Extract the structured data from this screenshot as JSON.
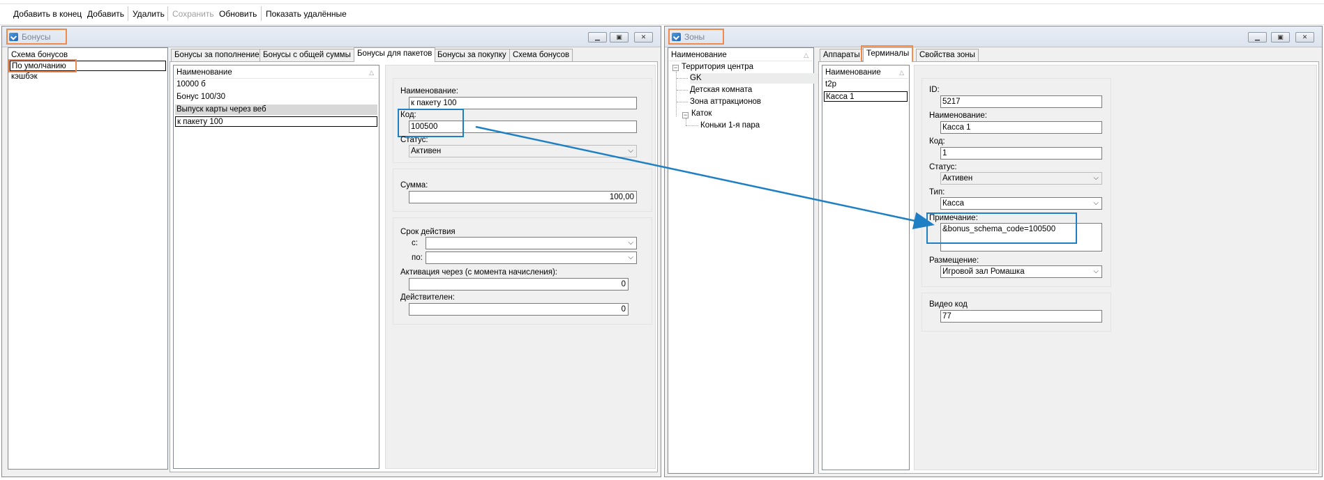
{
  "toolbar": {
    "add_end": "Добавить в конец",
    "add": "Добавить",
    "delete": "Удалить",
    "save": "Сохранить",
    "refresh": "Обновить",
    "show_deleted": "Показать удалённые"
  },
  "bonuses_window": {
    "title": "Бонусы",
    "schemes": [
      "Схема бонусов",
      "По умолчанию",
      "кэшбэк"
    ],
    "tabs": [
      "Бонусы за пополнение",
      "Бонусы с общей суммы",
      "Бонусы для пакетов",
      "Бонусы за покупку",
      "Схема бонусов"
    ],
    "list_header": "Наименование",
    "packages": [
      "10000 б",
      "Бонус 100/30",
      "Выпуск карты через веб",
      "к пакету 100"
    ],
    "form": {
      "name_label": "Наименование:",
      "name_value": "к пакету 100",
      "code_label": "Код:",
      "code_value": "100500",
      "status_label": "Статус:",
      "status_value": "Активен",
      "sum_label": "Сумма:",
      "sum_value": "100,00",
      "validity_label": "Срок действия",
      "from_label": "с:",
      "to_label": "по:",
      "activation_label": "Активация через (с момента начисления):",
      "activation_value": "0",
      "valid_label": "Действителен:",
      "valid_value": "0"
    }
  },
  "zones_window": {
    "title": "Зоны",
    "tree_header": "Наименование",
    "tree": {
      "root": "Территория центра",
      "children": [
        "GK",
        "Детская комната",
        "Зона аттракционов"
      ],
      "rink": "Каток",
      "rink_children": [
        "Коньки 1-я пара"
      ]
    },
    "tabs": [
      "Аппараты",
      "Терминалы",
      "Свойства зоны"
    ],
    "list_header": "Наименование",
    "terminals": [
      "t2p",
      "Касса 1"
    ],
    "form": {
      "id_label": "ID:",
      "id_value": "5217",
      "name_label": "Наименование:",
      "name_value": "Касса 1",
      "code_label": "Код:",
      "code_value": "1",
      "status_label": "Статус:",
      "status_value": "Активен",
      "type_label": "Тип:",
      "type_value": "Касса",
      "note_label": "Примечание:",
      "note_value": "&bonus_schema_code=100500",
      "placement_label": "Размещение:",
      "placement_value": "Игровой зал Ромашка",
      "video_label": "Видео код",
      "video_value": "77"
    }
  },
  "colors": {
    "highlight_orange": "#f08a4b",
    "highlight_blue": "#1e7fc4",
    "window_bg": "#f0f0f0"
  }
}
